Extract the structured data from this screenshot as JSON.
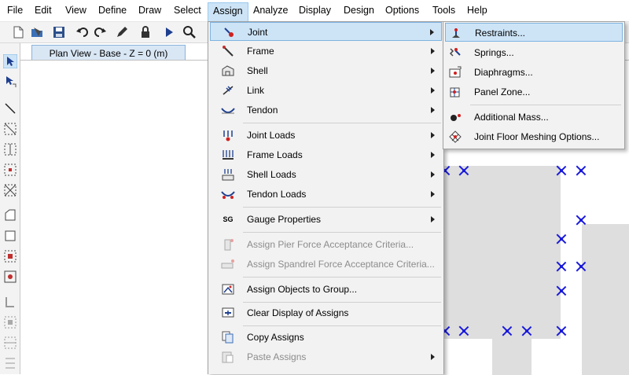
{
  "menubar": [
    "File",
    "Edit",
    "View",
    "Define",
    "Draw",
    "Select",
    "Assign",
    "Analyze",
    "Display",
    "Design",
    "Options",
    "Tools",
    "Help"
  ],
  "tab": "Plan View - Base - Z = 0 (m)",
  "assign_menu": {
    "joint": "Joint",
    "frame": "Frame",
    "shell": "Shell",
    "link": "Link",
    "tendon": "Tendon",
    "joint_loads": "Joint Loads",
    "frame_loads": "Frame Loads",
    "shell_loads": "Shell Loads",
    "tendon_loads": "Tendon Loads",
    "gauge_properties": "Gauge Properties",
    "gauge_icon_text": "SG",
    "pier_criteria": "Assign Pier Force Acceptance Criteria...",
    "spandrel_criteria": "Assign Spandrel Force Acceptance Criteria...",
    "objects_to_group": "Assign Objects to Group...",
    "clear_display": "Clear Display of Assigns",
    "copy_assigns": "Copy Assigns",
    "paste_assigns": "Paste Assigns"
  },
  "joint_submenu": {
    "restraints": "Restraints...",
    "springs": "Springs...",
    "diaphragms": "Diaphragms...",
    "panel_zone": "Panel Zone...",
    "additional_mass": "Additional Mass...",
    "floor_meshing": "Joint Floor Meshing Options..."
  },
  "colors": {
    "highlight": "#cde4f7",
    "joint_marker": "#1a1adb",
    "menu_bg": "#f2f2f2"
  }
}
